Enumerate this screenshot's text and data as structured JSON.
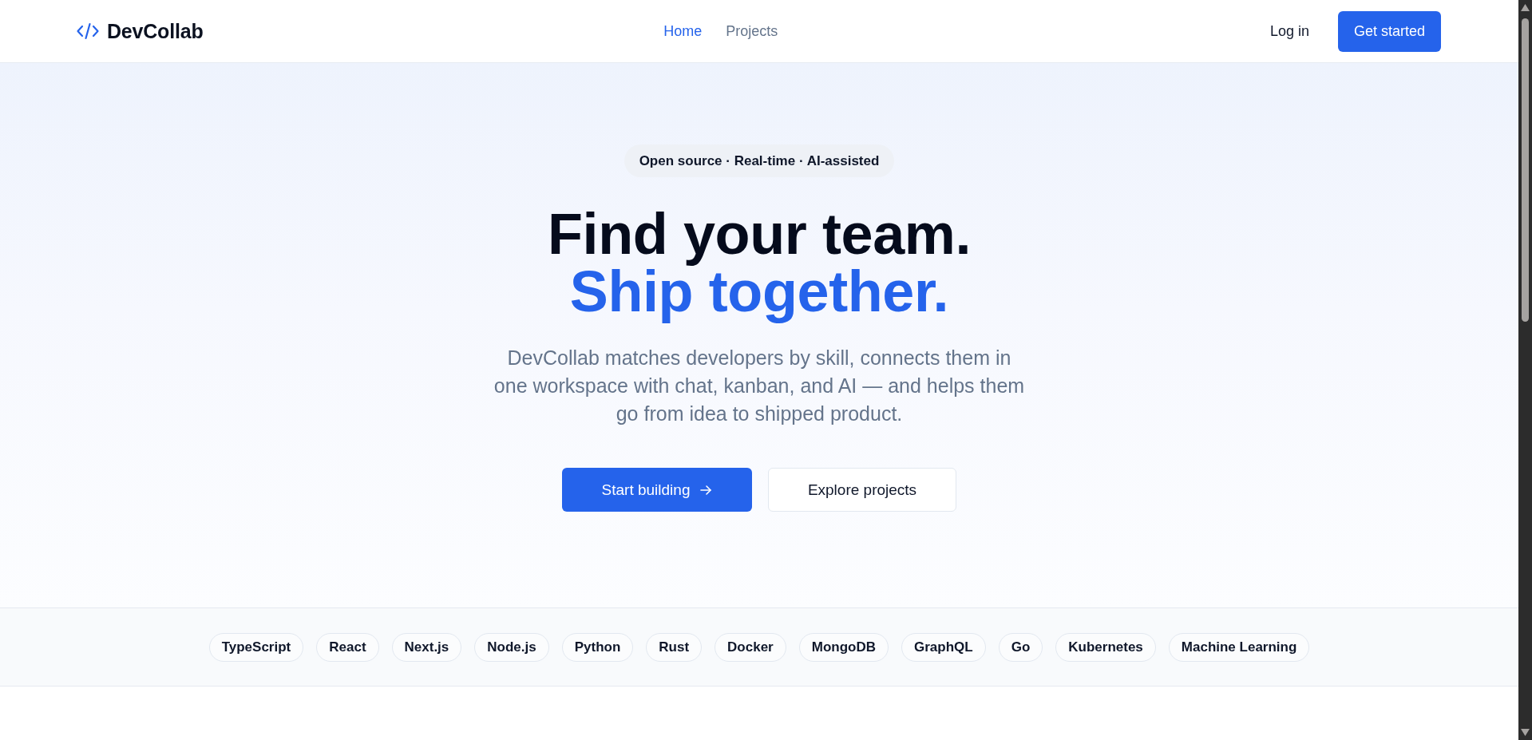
{
  "header": {
    "brand": "DevCollab",
    "nav": [
      {
        "label": "Home",
        "selected": true
      },
      {
        "label": "Projects",
        "selected": false
      }
    ],
    "login": "Log in",
    "cta": "Get started"
  },
  "hero": {
    "badge": "Open source · Real-time · AI-assisted",
    "headline": "Find your team.",
    "headline_accent": "Ship together.",
    "description": "DevCollab matches developers by skill, connects them in one workspace with chat, kanban, and AI — and helps them go from idea to shipped product.",
    "buttons": [
      {
        "label": "Start building",
        "kind": "primary"
      },
      {
        "label": "Explore projects",
        "kind": "secondary"
      }
    ]
  },
  "skills": [
    "TypeScript",
    "React",
    "Next.js",
    "Node.js",
    "Python",
    "Rust",
    "Docker",
    "MongoDB",
    "GraphQL",
    "Go",
    "Kubernetes",
    "Machine Learning"
  ]
}
